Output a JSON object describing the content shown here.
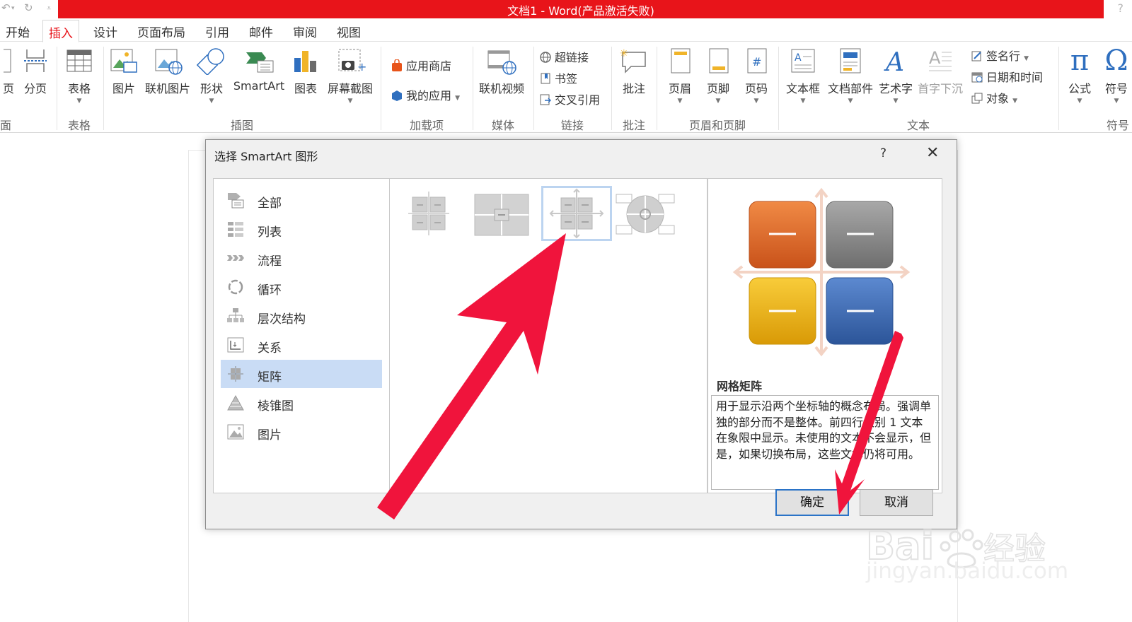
{
  "window": {
    "title": "文档1 -  Word(产品激活失败)",
    "help_glyph": "?"
  },
  "quick_access": {
    "icons": [
      "undo-icon",
      "redo-icon",
      "customize-icon"
    ]
  },
  "tabs": [
    {
      "label": "开始"
    },
    {
      "label": "插入",
      "active": true
    },
    {
      "label": "设计"
    },
    {
      "label": "页面布局"
    },
    {
      "label": "引用"
    },
    {
      "label": "邮件"
    },
    {
      "label": "审阅"
    },
    {
      "label": "视图"
    }
  ],
  "ribbon": {
    "pages_group": {
      "page_fragment": "页",
      "page_break": "分页",
      "label_fragment": "面"
    },
    "tables_group": {
      "table": "表格",
      "label": "表格"
    },
    "illustrations_group": {
      "picture": "图片",
      "online_picture": "联机图片",
      "shapes": "形状",
      "smartart": "SmartArt",
      "chart": "图表",
      "screenshot": "屏幕截图",
      "label": "插图"
    },
    "addins_group": {
      "store": "应用商店",
      "my_apps": "我的应用",
      "label": "加载项"
    },
    "media_group": {
      "online_video": "联机视频",
      "label": "媒体"
    },
    "links_group": {
      "hyperlink": "超链接",
      "bookmark": "书签",
      "cross_ref": "交叉引用",
      "label": "链接"
    },
    "comments_group": {
      "comment": "批注",
      "label": "批注"
    },
    "header_footer_group": {
      "header": "页眉",
      "footer": "页脚",
      "page_number": "页码",
      "label": "页眉和页脚"
    },
    "text_group": {
      "textbox": "文本框",
      "quick_parts": "文档部件",
      "wordart": "艺术字",
      "dropcap": "首字下沉",
      "signature": "签名行",
      "datetime": "日期和时间",
      "object": "对象",
      "label": "文本"
    },
    "symbols_group": {
      "equation": "公式",
      "symbol": "符号",
      "label": "符号",
      "pi_glyph": "π",
      "omega_glyph": "Ω"
    },
    "colors": {
      "accent": "#e8141a",
      "icon_blue": "#2f6fbf",
      "icon_gray": "#6b6b6b",
      "icon_green": "#3a8a52"
    }
  },
  "dialog": {
    "title": "选择 SmartArt 图形",
    "help_glyph": "?",
    "close_glyph": "✕",
    "categories": [
      {
        "label": "全部",
        "icon": "all-icon"
      },
      {
        "label": "列表",
        "icon": "list-icon"
      },
      {
        "label": "流程",
        "icon": "process-icon"
      },
      {
        "label": "循环",
        "icon": "cycle-icon"
      },
      {
        "label": "层次结构",
        "icon": "hierarchy-icon"
      },
      {
        "label": "关系",
        "icon": "relationship-icon"
      },
      {
        "label": "矩阵",
        "icon": "matrix-icon",
        "selected": true
      },
      {
        "label": "棱锥图",
        "icon": "pyramid-icon"
      },
      {
        "label": "图片",
        "icon": "picture-icon"
      }
    ],
    "layouts": [
      {
        "icon": "basic-matrix-icon"
      },
      {
        "icon": "titled-matrix-icon"
      },
      {
        "icon": "grid-matrix-icon",
        "selected": true
      },
      {
        "icon": "cycle-matrix-icon"
      }
    ],
    "preview": {
      "name": "网格矩阵",
      "description": "用于显示沿两个坐标轴的概念布局。强调单独的部分而不是整体。前四行级别 1 文本在象限中显示。未使用的文本不会显示，但是，如果切换布局，这些文本仍将可用。",
      "quadrant_colors": [
        "#e06a26",
        "#8c8c8c",
        "#eeb413",
        "#3f6fb8"
      ]
    },
    "ok_label": "确定",
    "cancel_label": "取消"
  },
  "annotation": {
    "arrow_color": "#f0143c"
  },
  "watermark": {
    "brand": "Bai",
    "brand_cn": "经验",
    "url": "jingyan.baidu.com"
  }
}
